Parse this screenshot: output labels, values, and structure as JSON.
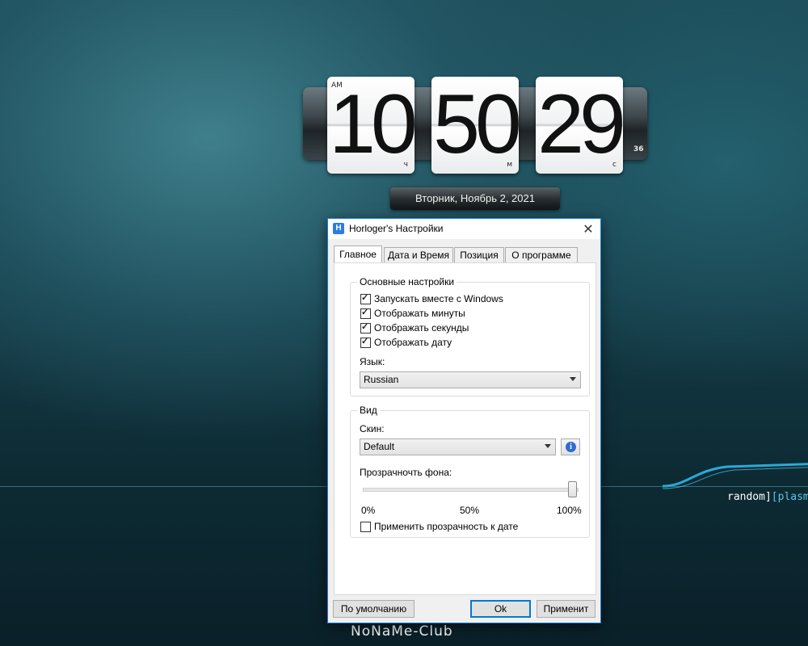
{
  "clock": {
    "hours": "10",
    "minutes": "50",
    "seconds": "29",
    "ampm": "AM",
    "hours_unit": "ч",
    "minutes_unit": "м",
    "seconds_unit": "с",
    "milliseconds": "36",
    "date": "Вторник, Ноябрь 2, 2021"
  },
  "dialog": {
    "title": "Horloger's Настройки",
    "icon_letter": "H",
    "close": "✕",
    "tabs": [
      "Главное",
      "Дата и Время",
      "Позиция",
      "О программе"
    ],
    "active_tab": "Главное",
    "general": {
      "group_title": "Основные настройки",
      "checkboxes": [
        {
          "label": "Запускать вместе с Windows",
          "checked": true
        },
        {
          "label": "Отображать минуты",
          "checked": true
        },
        {
          "label": "Отображать секунды",
          "checked": true
        },
        {
          "label": "Отображать дату",
          "checked": true
        }
      ],
      "language_label": "Язык:",
      "language_value": "Russian"
    },
    "view": {
      "group_title": "Вид",
      "skin_label": "Скин:",
      "skin_value": "Default",
      "info_icon": "i",
      "opacity_label": "Прозрачночть фона:",
      "opacity_value_percent": 100,
      "scale_min": "0%",
      "scale_mid": "50%",
      "scale_max": "100%",
      "apply_to_date_label": "Применить прозрачность к дате",
      "apply_to_date_checked": false
    },
    "buttons": {
      "defaults": "По умолчанию",
      "ok": "Ok",
      "apply": "Применит"
    }
  },
  "desktop": {
    "text_plain": "random]",
    "text_accent": "[plasmid",
    "watermark": "NoNaMe-Club"
  },
  "colors": {
    "accent": "#0078d7",
    "dialog_border": "#1883d7",
    "wallpaper_accent": "#56c8ea"
  }
}
